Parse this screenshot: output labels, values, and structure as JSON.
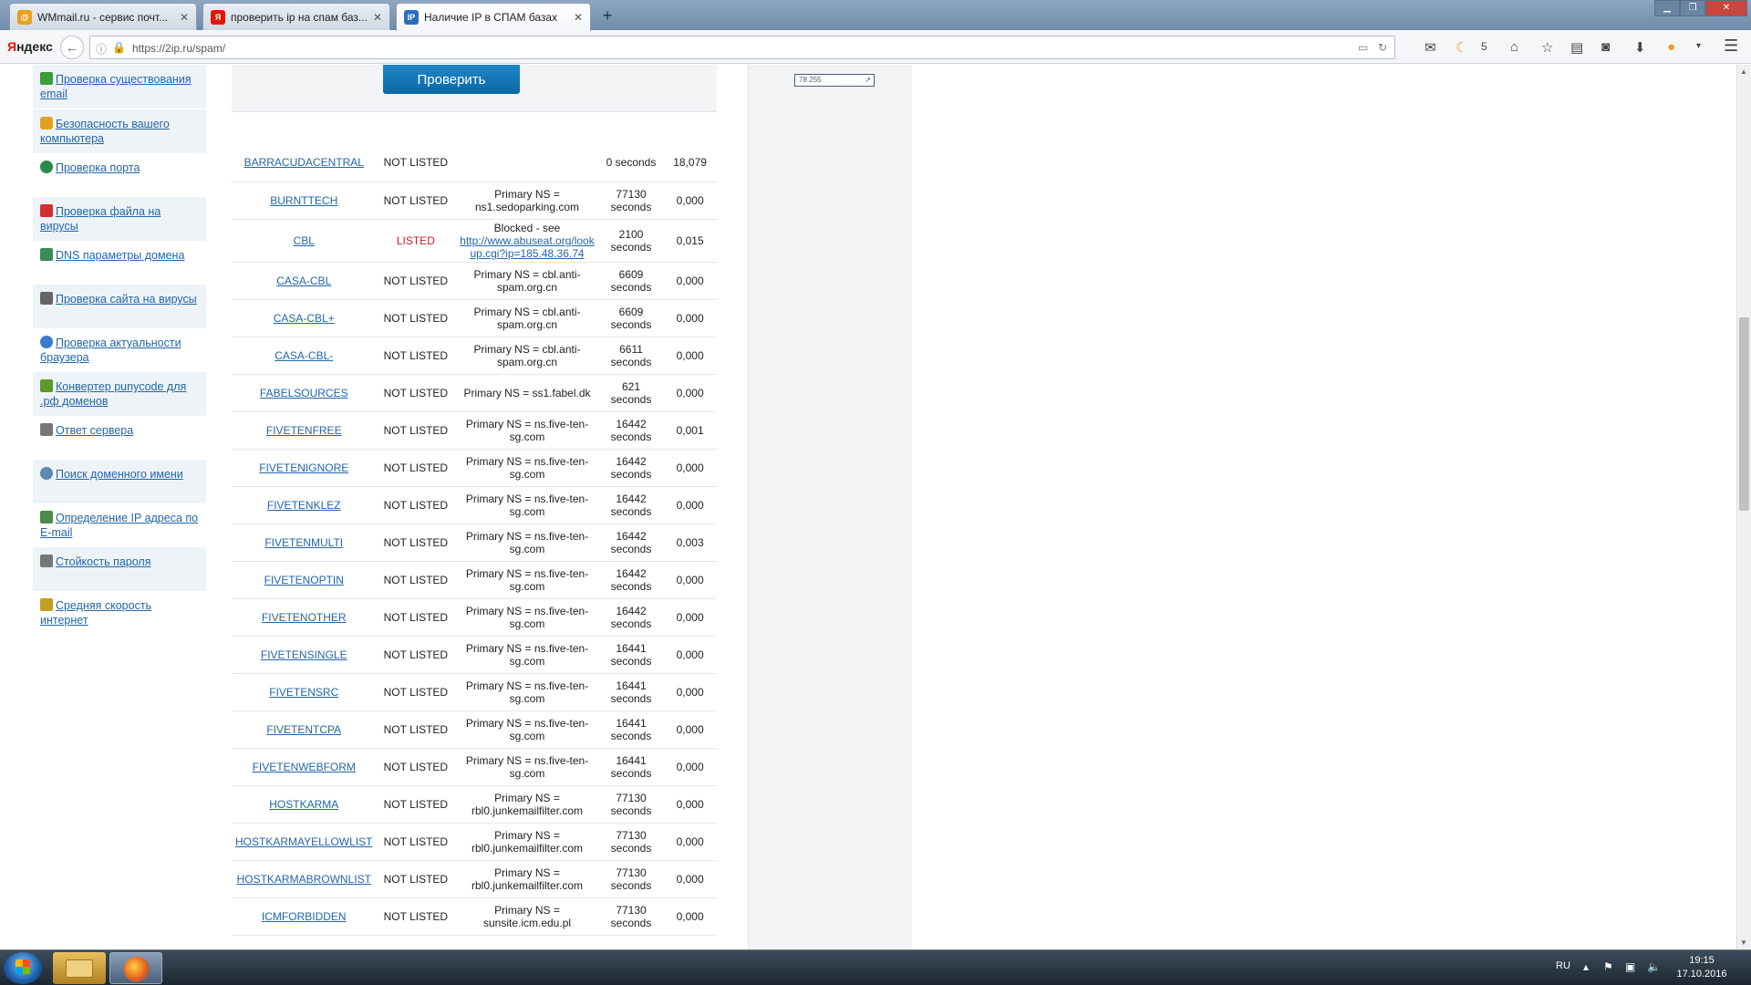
{
  "browser": {
    "tabs": [
      {
        "title": "WMmail.ru - сервис почт...",
        "favicon": "wmmail-icon",
        "color": "#e8a020"
      },
      {
        "title": "проверить ip на спам баз...",
        "favicon": "yandex-icon",
        "color": "#e61400"
      },
      {
        "title": "Наличие IP в СПАМ базах",
        "favicon": "2ip-icon",
        "color": "#2a6ebb",
        "favicon_text": "IP"
      }
    ],
    "logo": {
      "first": "Я",
      "rest": "ндекс"
    },
    "url": "https://2ip.ru/spam/",
    "weather": "5"
  },
  "sidebar": {
    "items": [
      {
        "label": "Проверка существования email",
        "icon": "mail-check-icon",
        "color": "#3a9c3a"
      },
      {
        "label": "Безопасность вашего компьютера",
        "icon": "lock-icon",
        "color": "#e3a020"
      },
      {
        "label": "Проверка порта",
        "icon": "globe-icon",
        "color": "#2a8a4a"
      },
      {
        "label": "Проверка файла на вирусы",
        "icon": "virus-file-icon",
        "color": "#d03030"
      },
      {
        "label": "DNS параметры домена",
        "icon": "dns-icon",
        "color": "#3a8a5a"
      },
      {
        "label": "Проверка сайта на вирусы",
        "icon": "site-virus-icon",
        "color": "#666666"
      },
      {
        "label": "Проверка актуальности браузера",
        "icon": "browser-icon",
        "color": "#3a7acc"
      },
      {
        "label": "Конвертер punycode для .рф доменов",
        "icon": "punycode-icon",
        "color": "#5a9a2a"
      },
      {
        "label": "Ответ сервера",
        "icon": "server-icon",
        "color": "#777777"
      },
      {
        "label": "Поиск доменного имени",
        "icon": "domain-search-icon",
        "color": "#5a8ab0"
      },
      {
        "label": "Определение IP адреса по E-mail",
        "icon": "ip-email-icon",
        "color": "#4a8a4a"
      },
      {
        "label": "Стойкость пароля",
        "icon": "password-icon",
        "color": "#777777"
      },
      {
        "label": "Средняя скорость интернет",
        "icon": "speed-icon",
        "color": "#c0a020"
      }
    ]
  },
  "main": {
    "check_button": "Проверить",
    "rows": [
      {
        "name": "BARRACUDACENTRAL",
        "status": "NOT LISTED",
        "ns": "",
        "ttl": "0 seconds",
        "time": "18,079"
      },
      {
        "name": "BURNTTECH",
        "status": "NOT LISTED",
        "ns": "Primary NS = ns1.sedoparking.com",
        "ttl": "77130 seconds",
        "time": "0,000"
      },
      {
        "name": "CBL",
        "status": "LISTED",
        "ns_prefix": "Blocked - see",
        "ns_link": "http://www.abuseat.org/lookup.cgi?ip=185.48.36.74",
        "ttl": "2100 seconds",
        "time": "0,015"
      },
      {
        "name": "CASA-CBL",
        "status": "NOT LISTED",
        "ns": "Primary NS = cbl.anti-spam.org.cn",
        "ttl": "6609 seconds",
        "time": "0,000"
      },
      {
        "name": "CASA-CBL+",
        "status": "NOT LISTED",
        "ns": "Primary NS = cbl.anti-spam.org.cn",
        "ttl": "6609 seconds",
        "time": "0,000"
      },
      {
        "name": "CASA-CBL-",
        "status": "NOT LISTED",
        "ns": "Primary NS = cbl.anti-spam.org.cn",
        "ttl": "6611 seconds",
        "time": "0,000"
      },
      {
        "name": "FABELSOURCES",
        "status": "NOT LISTED",
        "ns": "Primary NS = ss1.fabel.dk",
        "ttl": "621 seconds",
        "time": "0,000"
      },
      {
        "name": "FIVETENFREE",
        "status": "NOT LISTED",
        "ns": "Primary NS = ns.five-ten-sg.com",
        "ttl": "16442 seconds",
        "time": "0,001"
      },
      {
        "name": "FIVETENIGNORE",
        "status": "NOT LISTED",
        "ns": "Primary NS = ns.five-ten-sg.com",
        "ttl": "16442 seconds",
        "time": "0,000"
      },
      {
        "name": "FIVETENKLEZ",
        "status": "NOT LISTED",
        "ns": "Primary NS = ns.five-ten-sg.com",
        "ttl": "16442 seconds",
        "time": "0,000"
      },
      {
        "name": "FIVETENMULTI",
        "status": "NOT LISTED",
        "ns": "Primary NS = ns.five-ten-sg.com",
        "ttl": "16442 seconds",
        "time": "0,003"
      },
      {
        "name": "FIVETENOPTIN",
        "status": "NOT LISTED",
        "ns": "Primary NS = ns.five-ten-sg.com",
        "ttl": "16442 seconds",
        "time": "0,000"
      },
      {
        "name": "FIVETENOTHER",
        "status": "NOT LISTED",
        "ns": "Primary NS = ns.five-ten-sg.com",
        "ttl": "16442 seconds",
        "time": "0,000"
      },
      {
        "name": "FIVETENSINGLE",
        "status": "NOT LISTED",
        "ns": "Primary NS = ns.five-ten-sg.com",
        "ttl": "16441 seconds",
        "time": "0,000"
      },
      {
        "name": "FIVETENSRC",
        "status": "NOT LISTED",
        "ns": "Primary NS = ns.five-ten-sg.com",
        "ttl": "16441 seconds",
        "time": "0,000"
      },
      {
        "name": "FIVETENTCPA",
        "status": "NOT LISTED",
        "ns": "Primary NS = ns.five-ten-sg.com",
        "ttl": "16441 seconds",
        "time": "0,000"
      },
      {
        "name": "FIVETENWEBFORM",
        "status": "NOT LISTED",
        "ns": "Primary NS = ns.five-ten-sg.com",
        "ttl": "16441 seconds",
        "time": "0,000"
      },
      {
        "name": "HOSTKARMA",
        "status": "NOT LISTED",
        "ns": "Primary NS = rbl0.junkemailfilter.com",
        "ttl": "77130 seconds",
        "time": "0,000"
      },
      {
        "name": "HOSTKARMAYELLOWLIST",
        "status": "NOT LISTED",
        "ns": "Primary NS = rbl0.junkemailfilter.com",
        "ttl": "77130 seconds",
        "time": "0,000"
      },
      {
        "name": "HOSTKARMABROWNLIST",
        "status": "NOT LISTED",
        "ns": "Primary NS = rbl0.junkemailfilter.com",
        "ttl": "77130 seconds",
        "time": "0,000"
      },
      {
        "name": "ICMFORBIDDEN",
        "status": "NOT LISTED",
        "ns": "Primary NS = sunsite.icm.edu.pl",
        "ttl": "77130 seconds",
        "time": "0,000"
      }
    ]
  },
  "ad": {
    "banner_text": "78 255"
  },
  "taskbar": {
    "lang": "RU",
    "time": "19:15",
    "date": "17.10.2016"
  }
}
